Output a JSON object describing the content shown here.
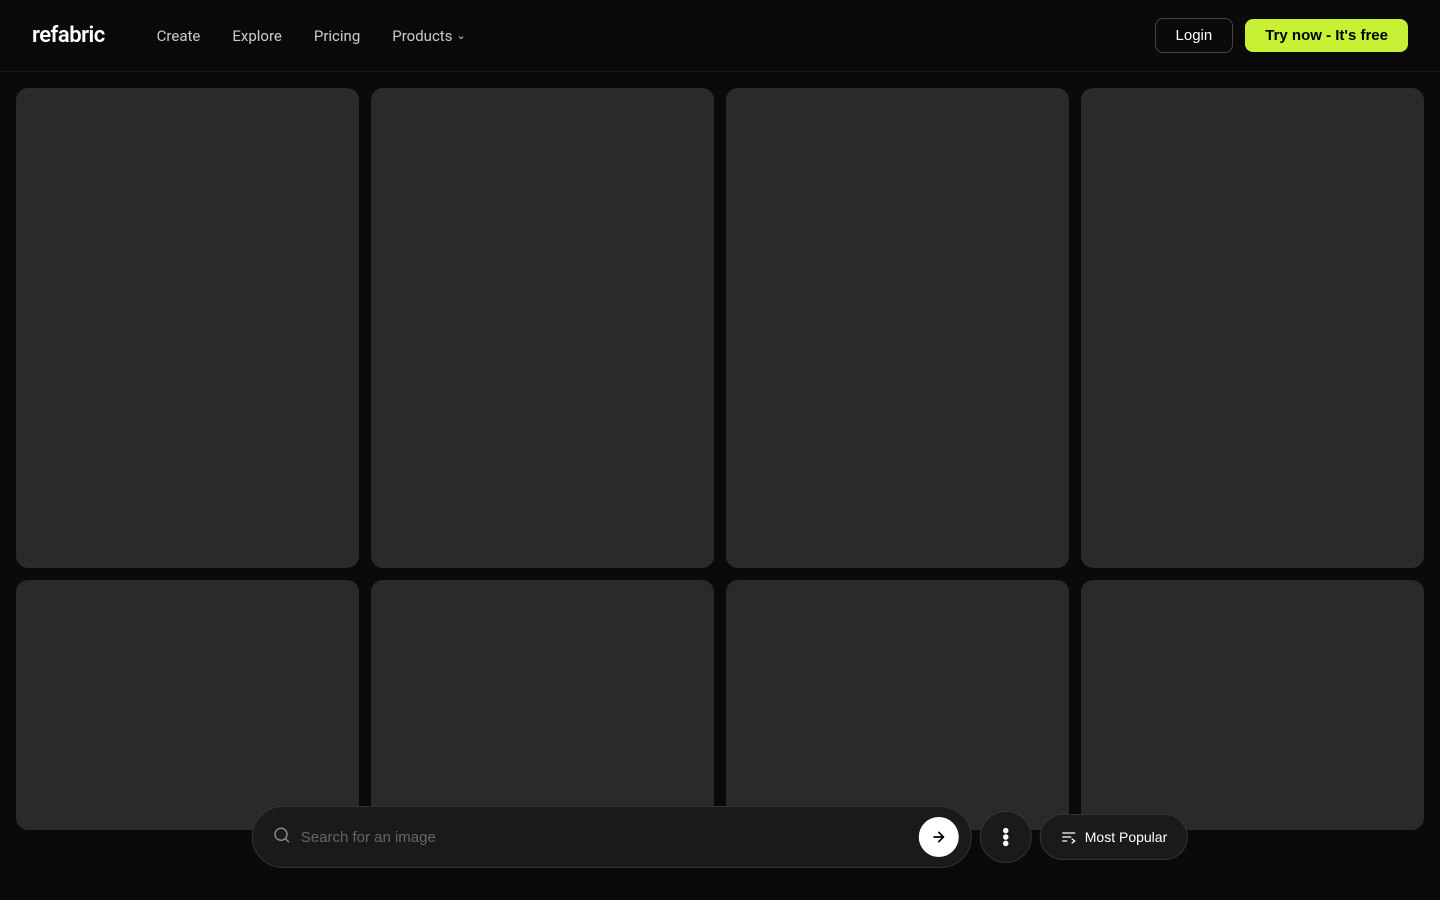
{
  "header": {
    "logo": "refabric",
    "nav": {
      "create": "Create",
      "explore": "Explore",
      "pricing": "Pricing",
      "products": "Products"
    },
    "buttons": {
      "login": "Login",
      "try_now": "Try now - It's free"
    }
  },
  "grid": {
    "rows": [
      [
        {
          "id": "item-1",
          "height": "tall"
        },
        {
          "id": "item-2",
          "height": "tall"
        },
        {
          "id": "item-3",
          "height": "tall"
        },
        {
          "id": "item-4",
          "height": "tall"
        }
      ],
      [
        {
          "id": "item-5",
          "height": "short"
        },
        {
          "id": "item-6",
          "height": "short"
        },
        {
          "id": "item-7",
          "height": "short"
        },
        {
          "id": "item-8",
          "height": "short"
        }
      ]
    ]
  },
  "search_bar": {
    "placeholder": "Search for an image",
    "sort_label": "Most Popular"
  }
}
